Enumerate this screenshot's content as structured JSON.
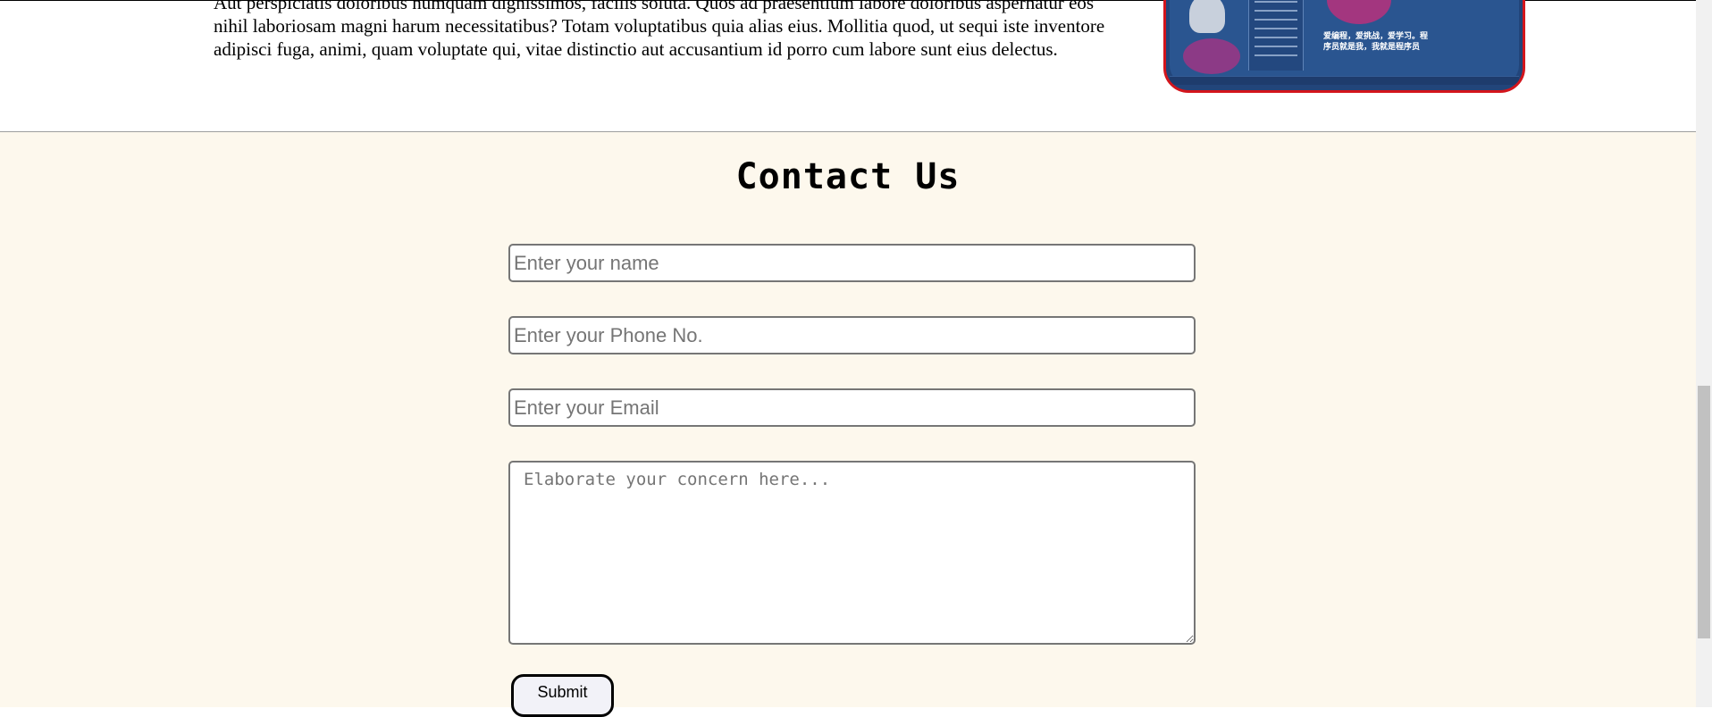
{
  "about": {
    "paragraph": "Aut perspiciatis doloribus numquam dignissimos, facilis soluta. Quos ad praesentium labore doloribus aspernatur eos nihil laboriosam magni harum necessitatibus? Totam voluptatibus quia alias eius. Mollitia quod, ut sequi iste inventore adipisci fuga, animi, quam voluptate qui, vitae distinctio aut accusantium id porro cum labore sunt eius delectus.",
    "image": {
      "caption": "爱编程，爱挑战，爱学习。程序员就是我，我就是程序员",
      "border_color": "#d3151c",
      "background_color": "#22457a"
    }
  },
  "contact": {
    "title": "Contact Us",
    "name_placeholder": "Enter your name",
    "phone_placeholder": "Enter your Phone No.",
    "email_placeholder": "Enter your Email",
    "concern_placeholder": "Elaborate your concern here...",
    "submit_label": "Submit",
    "background_color": "#fdf8ed"
  }
}
